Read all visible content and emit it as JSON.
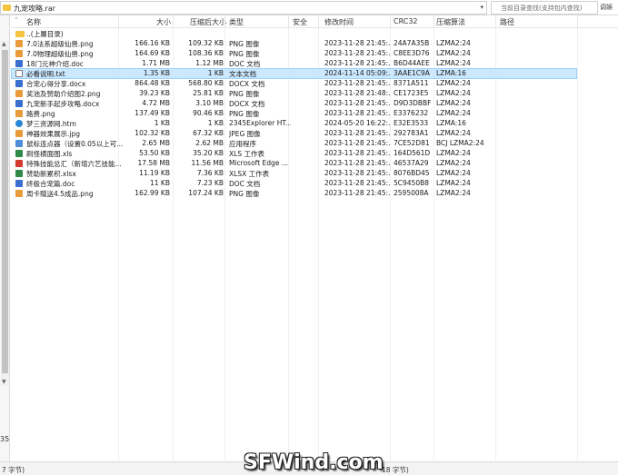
{
  "address_bar": {
    "path": "九宠攻略.rar"
  },
  "search": {
    "placeholder": "当前目录查找(支持包内查找)",
    "button": "调娱"
  },
  "columns": [
    {
      "key": "name",
      "label": "名称"
    },
    {
      "key": "size",
      "label": "大小"
    },
    {
      "key": "packed",
      "label": "压缩后大小"
    },
    {
      "key": "type",
      "label": "类型"
    },
    {
      "key": "security",
      "label": "安全"
    },
    {
      "key": "mtime",
      "label": "修改时间"
    },
    {
      "key": "crc",
      "label": "CRC32"
    },
    {
      "key": "method",
      "label": "压缩算法"
    },
    {
      "key": "path",
      "label": "路径"
    }
  ],
  "rows": [
    {
      "icon": "folder",
      "name": "..(上層目录)",
      "size": "",
      "packed": "",
      "type": "",
      "mtime": "",
      "crc": "",
      "method": ""
    },
    {
      "icon": "png",
      "name": "7.0法系超级仙兽.png",
      "size": "166.16 KB",
      "packed": "109.32 KB",
      "type": "PNG 图像",
      "mtime": "2023-11-28 21:45:...",
      "crc": "24A7A35B",
      "method": "LZMA2:24"
    },
    {
      "icon": "png",
      "name": "7.0物理超级仙兽.png",
      "size": "164.69 KB",
      "packed": "108.36 KB",
      "type": "PNG 图像",
      "mtime": "2023-11-28 21:45:...",
      "crc": "C8EE3D76",
      "method": "LZMA2:24"
    },
    {
      "icon": "doc",
      "name": "18门元神介绍.doc",
      "size": "1.71 MB",
      "packed": "1.12 MB",
      "type": "DOC 文档",
      "mtime": "2023-11-28 21:45:...",
      "crc": "B6D44AEE",
      "method": "LZMA2:24"
    },
    {
      "icon": "txt",
      "name": "必看说明.txt",
      "size": "1.35 KB",
      "packed": "1 KB",
      "type": "文本文档",
      "mtime": "2024-11-14 05:09:...",
      "crc": "3AAE1C9A",
      "method": "LZMA:16",
      "selected": true
    },
    {
      "icon": "doc",
      "name": "合宠心得分享.docx",
      "size": "864.48 KB",
      "packed": "568.80 KB",
      "type": "DOCX 文档",
      "mtime": "2023-11-28 21:45:...",
      "crc": "8371A511",
      "method": "LZMA2:24"
    },
    {
      "icon": "png",
      "name": "奖池及赞助介绍图2.png",
      "size": "39.23 KB",
      "packed": "25.81 KB",
      "type": "PNG 图像",
      "mtime": "2023-11-28 21:48:...",
      "crc": "CE1723E5",
      "method": "LZMA2:24"
    },
    {
      "icon": "doc",
      "name": "九宠新手起步攻略.docx",
      "size": "4.72 MB",
      "packed": "3.10 MB",
      "type": "DOCX 文档",
      "mtime": "2023-11-28 21:45:...",
      "crc": "D9D3DBBF",
      "method": "LZMA2:24"
    },
    {
      "icon": "png",
      "name": "路费.png",
      "size": "137.49 KB",
      "packed": "90.46 KB",
      "type": "PNG 图像",
      "mtime": "2023-11-28 21:45:...",
      "crc": "E3376232",
      "method": "LZMA2:24"
    },
    {
      "icon": "htm",
      "name": "梦三资源网.htm",
      "size": "1 KB",
      "packed": "1 KB",
      "type": "2345Explorer HT...",
      "mtime": "2024-05-20 16:22:...",
      "crc": "E32E3533",
      "method": "LZMA:16"
    },
    {
      "icon": "jpg",
      "name": "神器效果展示.jpg",
      "size": "102.32 KB",
      "packed": "67.32 KB",
      "type": "JPEG 图像",
      "mtime": "2023-11-28 21:45:...",
      "crc": "292783A1",
      "method": "LZMA2:24"
    },
    {
      "icon": "exe",
      "name": "鼠标连点器（设置0.05以上可...",
      "size": "2.65 MB",
      "packed": "2.62 MB",
      "type": "应用程序",
      "mtime": "2023-11-28 21:45:...",
      "crc": "7CE52D81",
      "method": "BCJ LZMA2:24"
    },
    {
      "icon": "xls",
      "name": "刷怪横面图.xls",
      "size": "53.50 KB",
      "packed": "35.20 KB",
      "type": "XLS 工作表",
      "mtime": "2023-11-28 21:45:...",
      "crc": "164D561D",
      "method": "LZMA2:24"
    },
    {
      "icon": "pdf",
      "name": "特殊技能总汇（新增六艺技能...",
      "size": "17.58 MB",
      "packed": "11.56 MB",
      "type": "Microsoft Edge ...",
      "mtime": "2023-11-28 21:45:...",
      "crc": "46537A29",
      "method": "LZMA2:24"
    },
    {
      "icon": "xlsx",
      "name": "赞助新累积.xlsx",
      "size": "11.19 KB",
      "packed": "7.36 KB",
      "type": "XLSX 工作表",
      "mtime": "2023-11-28 21:45:...",
      "crc": "8076BD45",
      "method": "LZMA2:24"
    },
    {
      "icon": "doc",
      "name": "终极合宠篇.doc",
      "size": "11 KB",
      "packed": "7.23 KB",
      "type": "DOC 文档",
      "mtime": "2023-11-28 21:45:...",
      "crc": "5C9450B8",
      "method": "LZMA2:24"
    },
    {
      "icon": "png",
      "name": "周卡赠送4.5成品.png",
      "size": "162.99 KB",
      "packed": "107.24 KB",
      "type": "PNG 图像",
      "mtime": "2023-11-28 21:45:...",
      "crc": "2595008A",
      "method": "LZMA2:24"
    }
  ],
  "left_panel": {
    "number": "35"
  },
  "status": {
    "left": "7 字节)",
    "right": "18 字节)"
  },
  "watermark": "SFWind.com"
}
